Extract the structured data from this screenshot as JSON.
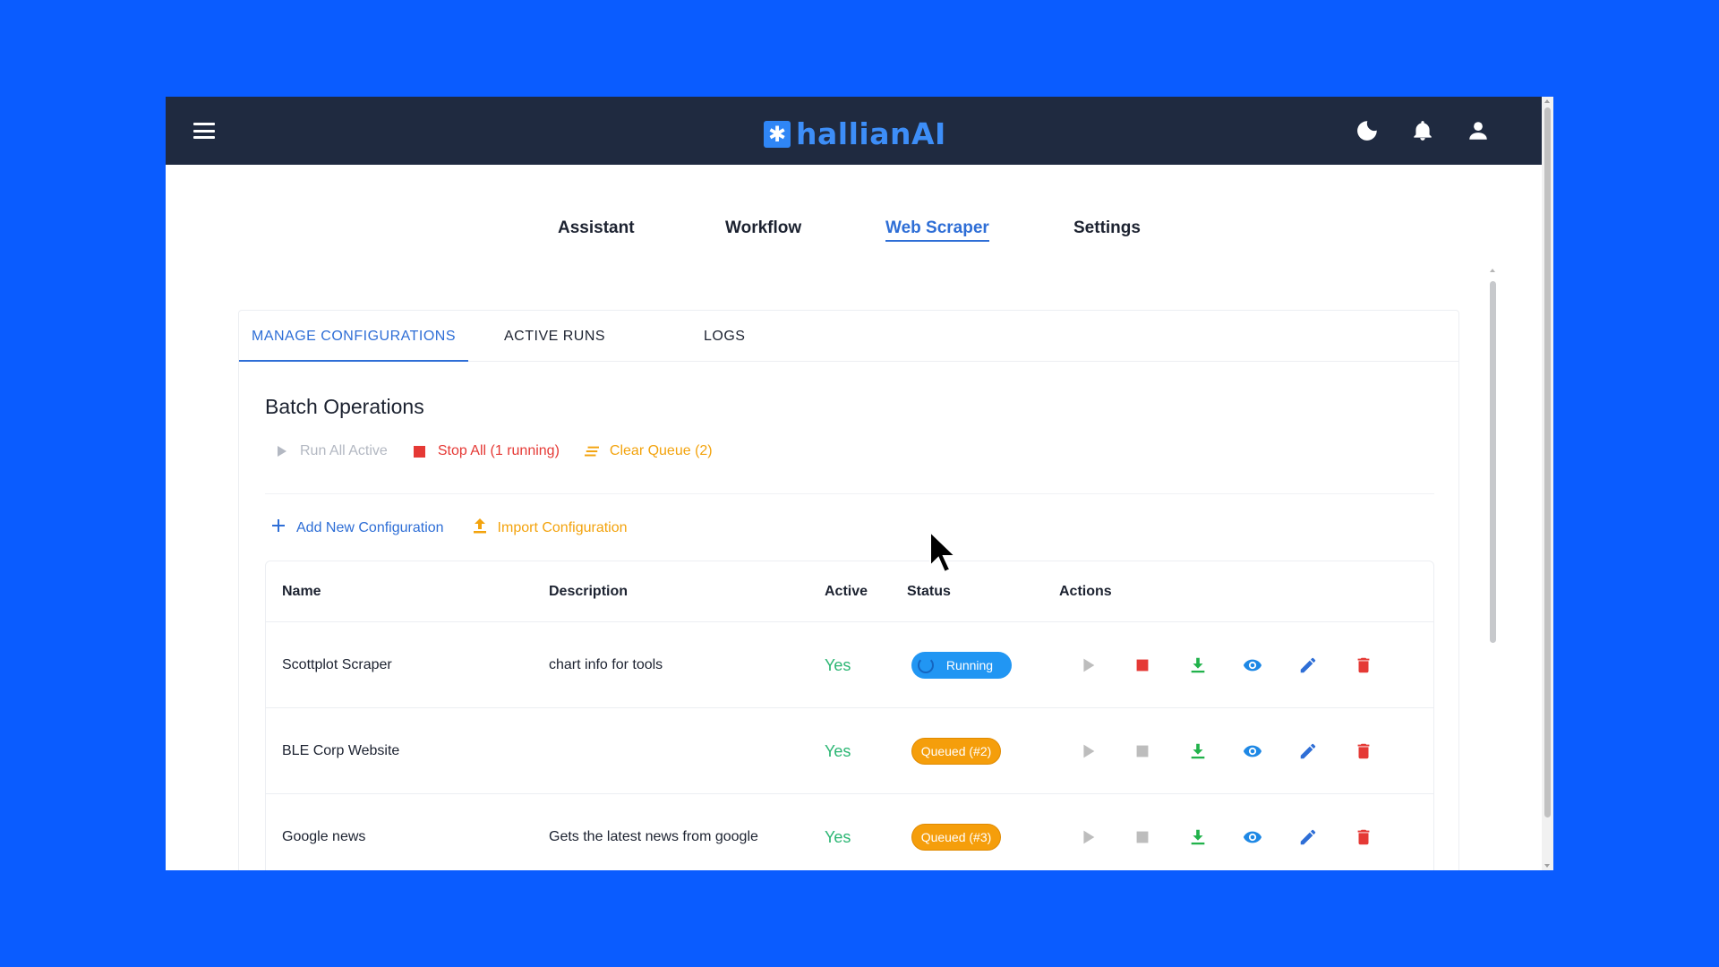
{
  "app": {
    "brand": "hallianAI",
    "logo_glyph": "✱"
  },
  "header": {
    "icons": [
      "menu-icon",
      "moon-icon",
      "bell-icon",
      "user-icon"
    ]
  },
  "nav": {
    "items": [
      {
        "label": "Assistant"
      },
      {
        "label": "Workflow"
      },
      {
        "label": "Web Scraper"
      },
      {
        "label": "Settings"
      }
    ],
    "active": "Web Scraper"
  },
  "tabs": {
    "items": [
      {
        "label": "MANAGE CONFIGURATIONS"
      },
      {
        "label": "ACTIVE RUNS"
      },
      {
        "label": "LOGS"
      }
    ],
    "active": "MANAGE CONFIGURATIONS"
  },
  "batch": {
    "title": "Batch Operations",
    "run_all": "Run All Active",
    "stop_all": "Stop All (1 running)",
    "clear_queue": "Clear Queue (2)"
  },
  "config_actions": {
    "add": "Add New Configuration",
    "import": "Import Configuration"
  },
  "table": {
    "headers": [
      "Name",
      "Description",
      "Active",
      "Status",
      "Actions"
    ],
    "rows": [
      {
        "name": "Scottplot Scraper",
        "description": "chart info for tools",
        "active": "Yes",
        "status": "Running",
        "status_type": "running"
      },
      {
        "name": "BLE Corp Website",
        "description": "",
        "active": "Yes",
        "status": "Queued (#2)",
        "status_type": "queued"
      },
      {
        "name": "Google news",
        "description": "Gets the latest news from google",
        "active": "Yes",
        "status": "Queued (#3)",
        "status_type": "queued"
      }
    ]
  },
  "colors": {
    "page_bg": "#0a5cff",
    "header_bg": "#1f2a40",
    "accent": "#2e6ed6",
    "success": "#2bb673",
    "danger": "#e53935",
    "warning": "#f59e0b",
    "running": "#2196f3"
  }
}
